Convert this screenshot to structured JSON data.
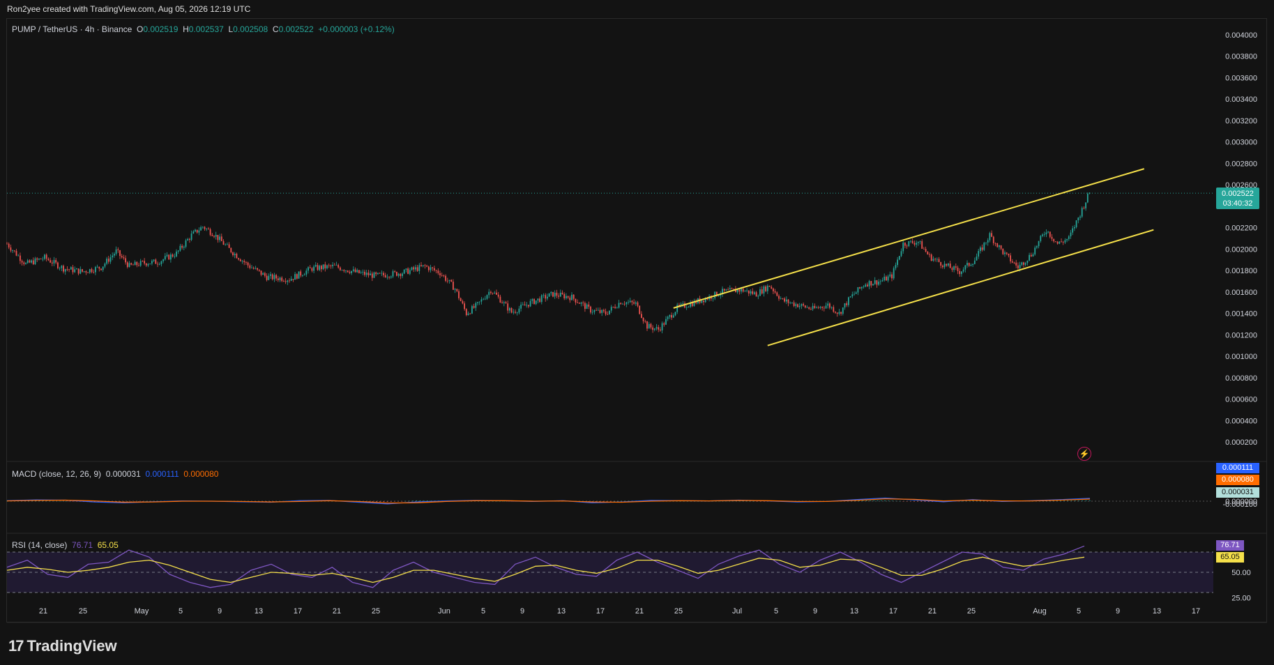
{
  "header": {
    "credit": "Ron2yee created with TradingView.com, Aug 05, 2026 12:19 UTC"
  },
  "symbol_legend": {
    "symbol": "PUMP / TetherUS · 4h · Binance",
    "o_label": "O",
    "o": "0.002519",
    "h_label": "H",
    "h": "0.002537",
    "l_label": "L",
    "l": "0.002508",
    "c_label": "C",
    "c": "0.002522",
    "change": "+0.000003 (+0.12%)"
  },
  "price_badge": {
    "price": "0.002522",
    "countdown": "03:40:32"
  },
  "macd_legend": {
    "label": "MACD (close, 12, 26, 9)",
    "hist": "0.000031",
    "macd": "0.000111",
    "signal": "0.000080"
  },
  "rsi_legend": {
    "label": "RSI (14, close)",
    "rsi": "76.71",
    "ma": "65.05"
  },
  "logo": {
    "text": "TradingView"
  },
  "colors": {
    "up": "#26a69a",
    "down": "#ef5350",
    "channel": "#f5e04a",
    "macd": "#2962ff",
    "signal": "#ff6d00",
    "rsi": "#7e57c2",
    "rsi_ma": "#f5e04a"
  },
  "chart_data": [
    {
      "type": "candlestick",
      "title": "PUMP / TetherUS · 4h · Binance",
      "x_ticks": [
        "21",
        "25",
        "May",
        "5",
        "9",
        "13",
        "17",
        "21",
        "25",
        "Jun",
        "5",
        "9",
        "13",
        "17",
        "21",
        "25",
        "Jul",
        "5",
        "9",
        "13",
        "17",
        "21",
        "25",
        "Aug",
        "5",
        "9",
        "13",
        "17"
      ],
      "y_ticks": [
        "0.004000",
        "0.003800",
        "0.003600",
        "0.003400",
        "0.003200",
        "0.003000",
        "0.002800",
        "0.002600",
        "0.002200",
        "0.002000",
        "0.001800",
        "0.001600",
        "0.001400",
        "0.001200",
        "0.001000",
        "0.000800",
        "0.000600",
        "0.000400",
        "0.000200"
      ],
      "ylim": [
        5e-05,
        0.00405
      ],
      "close_path": [
        {
          "x": 0,
          "y": 0.00205
        },
        {
          "x": 10,
          "y": 0.00186
        },
        {
          "x": 20,
          "y": 0.00192
        },
        {
          "x": 30,
          "y": 0.00182
        },
        {
          "x": 40,
          "y": 0.00179
        },
        {
          "x": 50,
          "y": 0.00183
        },
        {
          "x": 58,
          "y": 0.00198
        },
        {
          "x": 65,
          "y": 0.00184
        },
        {
          "x": 72,
          "y": 0.00187
        },
        {
          "x": 80,
          "y": 0.00188
        },
        {
          "x": 90,
          "y": 0.00196
        },
        {
          "x": 98,
          "y": 0.00213
        },
        {
          "x": 104,
          "y": 0.00221
        },
        {
          "x": 110,
          "y": 0.00214
        },
        {
          "x": 118,
          "y": 0.002
        },
        {
          "x": 128,
          "y": 0.00185
        },
        {
          "x": 138,
          "y": 0.00174
        },
        {
          "x": 150,
          "y": 0.00172
        },
        {
          "x": 162,
          "y": 0.00182
        },
        {
          "x": 174,
          "y": 0.00184
        },
        {
          "x": 186,
          "y": 0.00178
        },
        {
          "x": 196,
          "y": 0.00175
        },
        {
          "x": 210,
          "y": 0.00178
        },
        {
          "x": 222,
          "y": 0.00184
        },
        {
          "x": 230,
          "y": 0.00178
        },
        {
          "x": 238,
          "y": 0.00163
        },
        {
          "x": 244,
          "y": 0.0014
        },
        {
          "x": 250,
          "y": 0.00148
        },
        {
          "x": 257,
          "y": 0.00162
        },
        {
          "x": 262,
          "y": 0.00153
        },
        {
          "x": 268,
          "y": 0.00141
        },
        {
          "x": 278,
          "y": 0.0015
        },
        {
          "x": 290,
          "y": 0.00158
        },
        {
          "x": 300,
          "y": 0.00155
        },
        {
          "x": 310,
          "y": 0.00143
        },
        {
          "x": 318,
          "y": 0.0014
        },
        {
          "x": 326,
          "y": 0.00151
        },
        {
          "x": 334,
          "y": 0.00149
        },
        {
          "x": 340,
          "y": 0.00128
        },
        {
          "x": 346,
          "y": 0.00125
        },
        {
          "x": 356,
          "y": 0.00145
        },
        {
          "x": 368,
          "y": 0.00152
        },
        {
          "x": 380,
          "y": 0.0016
        },
        {
          "x": 390,
          "y": 0.00162
        },
        {
          "x": 398,
          "y": 0.00158
        },
        {
          "x": 405,
          "y": 0.00166
        },
        {
          "x": 412,
          "y": 0.00152
        },
        {
          "x": 420,
          "y": 0.00148
        },
        {
          "x": 428,
          "y": 0.00144
        },
        {
          "x": 436,
          "y": 0.00148
        },
        {
          "x": 442,
          "y": 0.0014
        },
        {
          "x": 448,
          "y": 0.00155
        },
        {
          "x": 456,
          "y": 0.00168
        },
        {
          "x": 464,
          "y": 0.0017
        },
        {
          "x": 470,
          "y": 0.00175
        },
        {
          "x": 476,
          "y": 0.00205
        },
        {
          "x": 484,
          "y": 0.00207
        },
        {
          "x": 490,
          "y": 0.00193
        },
        {
          "x": 498,
          "y": 0.00185
        },
        {
          "x": 506,
          "y": 0.00179
        },
        {
          "x": 514,
          "y": 0.0019
        },
        {
          "x": 522,
          "y": 0.00213
        },
        {
          "x": 530,
          "y": 0.00195
        },
        {
          "x": 537,
          "y": 0.00183
        },
        {
          "x": 544,
          "y": 0.00195
        },
        {
          "x": 552,
          "y": 0.00218
        },
        {
          "x": 558,
          "y": 0.00205
        },
        {
          "x": 564,
          "y": 0.0021
        },
        {
          "x": 570,
          "y": 0.00233
        },
        {
          "x": 575,
          "y": 0.00253
        }
      ],
      "channel_lines": [
        {
          "name": "upper",
          "points": [
            {
              "x": 354,
              "y": 0.00145
            },
            {
              "x": 604,
              "y": 0.00275
            }
          ]
        },
        {
          "name": "lower",
          "points": [
            {
              "x": 404,
              "y": 0.0011
            },
            {
              "x": 609,
              "y": 0.00218
            }
          ]
        }
      ],
      "last_price": 0.002522
    },
    {
      "type": "line",
      "title": "MACD (close, 12, 26, 9)",
      "y_ticks": [
        "0.000000",
        "-0.000100"
      ],
      "series": [
        {
          "name": "MACD",
          "values": [
            2e-05,
            5e-05,
            4e-05,
            -3e-05,
            -6e-05,
            -2e-05,
            1e-05,
            0.0,
            -2e-05,
            -4e-05,
            2e-05,
            3e-05,
            -4e-05,
            -0.0001,
            -3e-05,
            1e-05,
            3e-05,
            2e-05,
            -1e-05,
            2e-05,
            -6e-05,
            -3e-05,
            3e-05,
            2e-05,
            1e-05,
            4e-05,
            1e-05,
            -3e-05,
            -1e-05,
            6e-05,
            0.00012,
            5e-05,
            -2e-05,
            6e-05,
            -1e-05,
            2e-05,
            6e-05,
            0.00011
          ]
        },
        {
          "name": "Signal",
          "values": [
            1e-05,
            3e-05,
            4e-05,
            1e-05,
            -4e-05,
            -3e-05,
            0.0,
            0.0,
            -1e-05,
            -3e-05,
            -1e-05,
            2e-05,
            -1e-05,
            -7e-05,
            -6e-05,
            -1e-05,
            2e-05,
            2e-05,
            0.0,
            1e-05,
            -3e-05,
            -4e-05,
            0.0,
            2e-05,
            1e-05,
            3e-05,
            2e-05,
            -1e-05,
            -1e-05,
            3e-05,
            9e-05,
            7e-05,
            1e-05,
            4e-05,
            1e-05,
            1e-05,
            4e-05,
            8e-05
          ]
        }
      ]
    },
    {
      "type": "line",
      "title": "RSI (14, close)",
      "y_ticks": [
        "50.00",
        "25.00"
      ],
      "levels": [
        70,
        50,
        30
      ],
      "series": [
        {
          "name": "RSI",
          "values": [
            55,
            62,
            48,
            45,
            58,
            60,
            72,
            65,
            48,
            40,
            35,
            38,
            52,
            58,
            48,
            45,
            55,
            40,
            35,
            52,
            60,
            50,
            45,
            40,
            38,
            58,
            65,
            55,
            48,
            46,
            62,
            70,
            60,
            52,
            44,
            58,
            66,
            72,
            58,
            50,
            62,
            70,
            60,
            48,
            40,
            50,
            60,
            70,
            68,
            55,
            52,
            63,
            68,
            76
          ]
        },
        {
          "name": "RSI MA",
          "values": [
            52,
            55,
            53,
            50,
            52,
            55,
            60,
            62,
            57,
            50,
            43,
            40,
            45,
            50,
            49,
            47,
            49,
            45,
            40,
            45,
            52,
            52,
            48,
            44,
            41,
            48,
            56,
            57,
            52,
            49,
            54,
            62,
            62,
            56,
            49,
            52,
            58,
            64,
            62,
            55,
            57,
            63,
            62,
            55,
            47,
            47,
            53,
            61,
            65,
            60,
            56,
            58,
            62,
            65
          ]
        }
      ]
    }
  ]
}
